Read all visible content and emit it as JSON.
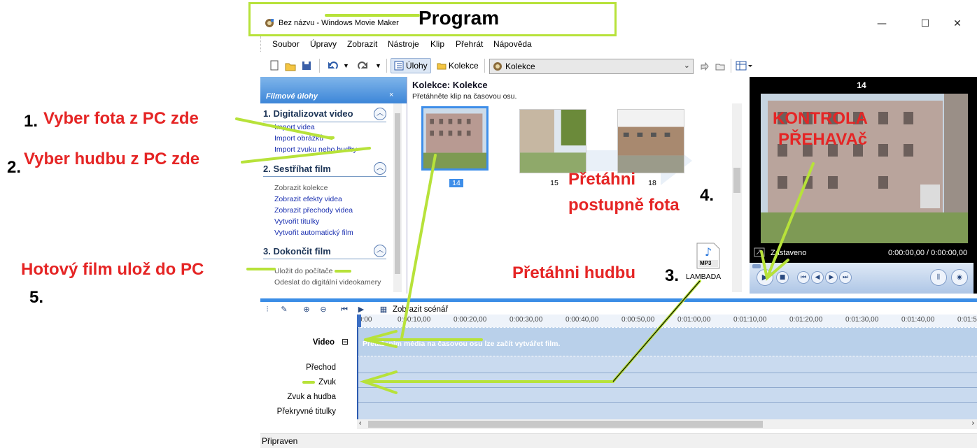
{
  "window": {
    "title": "Bez názvu - Windows Movie Maker",
    "buttons": {
      "minimize": "—",
      "maximize": "☐",
      "close": "✕"
    }
  },
  "menu": [
    "Soubor",
    "Úpravy",
    "Zobrazit",
    "Nástroje",
    "Klip",
    "Přehrát",
    "Nápověda"
  ],
  "toolbar": {
    "tasks_label": "Úlohy",
    "collections_label": "Kolekce",
    "collection_select_value": "Kolekce"
  },
  "tasks_pane": {
    "header": "Filmové úlohy",
    "close": "×",
    "sections": [
      {
        "title": "1. Digitalizovat video",
        "items": [
          "Import videa",
          "Import obrázků",
          "Import zvuku nebo hudby"
        ]
      },
      {
        "title": "2. Sestříhat film",
        "items": [
          "Zobrazit kolekce",
          "Zobrazit efekty videa",
          "Zobrazit přechody videa",
          "Vytvořit titulky",
          "Vytvořit automatický film"
        ]
      },
      {
        "title": "3. Dokončit film",
        "items": [
          "Uložit do počítače",
          "Odeslat do digitální videokamery"
        ]
      }
    ]
  },
  "collection": {
    "title": "Kolekce: Kolekce",
    "subtitle": "Přetáhněte klip na časovou osu.",
    "clips": [
      "14",
      "15",
      "18"
    ],
    "audio_clip": "LAMBADA",
    "audio_badge": "MP3"
  },
  "preview": {
    "clip_number": "14",
    "status": "Zastaveno",
    "time": "0:00:00,00 / 0:00:00,00"
  },
  "timeline": {
    "toolbar_label": "Zobrazit scénář",
    "ticks": [
      "0:00",
      "0:00:10,00",
      "0:00:20,00",
      "0:00:30,00",
      "0:00:40,00",
      "0:00:50,00",
      "0:01:00,00",
      "0:01:10,00",
      "0:01:20,00",
      "0:01:30,00",
      "0:01:40,00",
      "0:01:5"
    ],
    "tracks": [
      "Video",
      "Přechod",
      "Zvuk",
      "Zvuk a hudba",
      "Překryvné titulky"
    ],
    "video_hint": "Přetažením média na časovou osu lze začít vytvářet film.",
    "collapse": "⊟"
  },
  "status": "Připraven",
  "annotations": {
    "program": "Program",
    "a1_num": "1.",
    "a1_text": "Vyber fota z PC zde",
    "a2_num": "2.",
    "a2_text": "Vyber hudbu z PC zde",
    "a_save": "Hotový film ulož do PC",
    "a5_num": "5.",
    "a_kontrola1": "KONTROLA",
    "a_kontrola2": "PŘEHAVAč",
    "a_drag1": "Přetáhni",
    "a_drag2": "postupně fota",
    "a4_num": "4.",
    "a_music": "Přetáhni hudbu",
    "a3_num": "3."
  },
  "colors": {
    "accent": "#3b8de6",
    "annotation_red": "#e52525",
    "annotation_green": "#b7e23a"
  }
}
